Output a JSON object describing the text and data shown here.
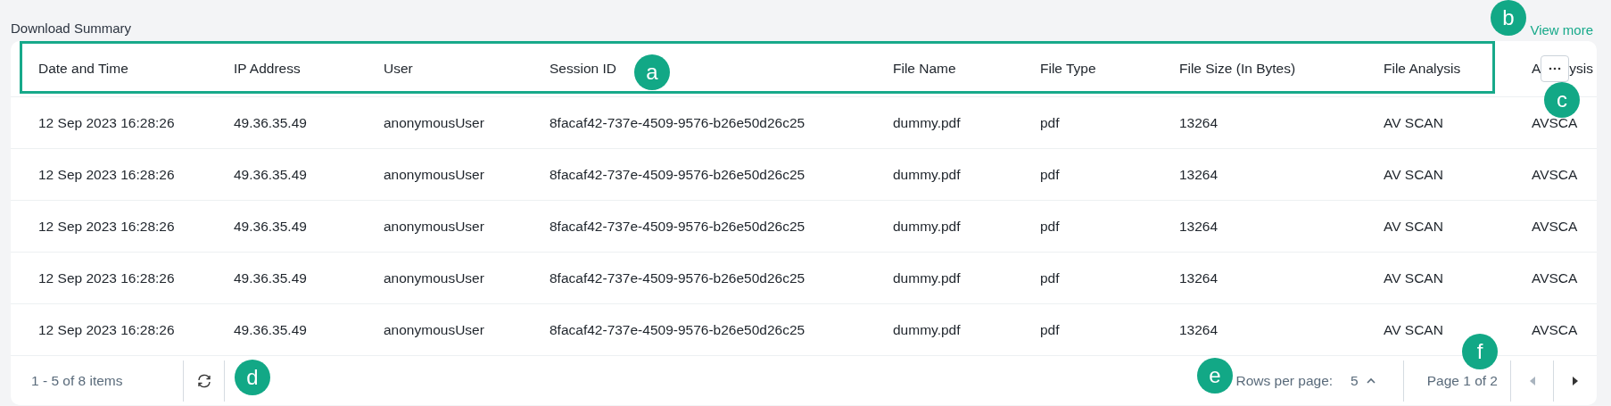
{
  "title": "Download Summary",
  "view_more": "View more",
  "table": {
    "columns": [
      "Date and Time",
      "IP Address",
      "User",
      "Session ID",
      "File Name",
      "File Type",
      "File Size (In Bytes)",
      "File Analysis"
    ],
    "column_9": {
      "label_start": "A",
      "label_end": "ysis"
    },
    "rows": [
      {
        "cells": [
          "12 Sep 2023 16:28:26",
          "49.36.35.49",
          "anonymousUser",
          "8facaf42-737e-4509-9576-b26e50d26c25",
          "dummy.pdf",
          "pdf",
          "13264",
          "AV SCAN",
          "AVSCA"
        ]
      },
      {
        "cells": [
          "12 Sep 2023 16:28:26",
          "49.36.35.49",
          "anonymousUser",
          "8facaf42-737e-4509-9576-b26e50d26c25",
          "dummy.pdf",
          "pdf",
          "13264",
          "AV SCAN",
          "AVSCA"
        ]
      },
      {
        "cells": [
          "12 Sep 2023 16:28:26",
          "49.36.35.49",
          "anonymousUser",
          "8facaf42-737e-4509-9576-b26e50d26c25",
          "dummy.pdf",
          "pdf",
          "13264",
          "AV SCAN",
          "AVSCA"
        ]
      },
      {
        "cells": [
          "12 Sep 2023 16:28:26",
          "49.36.35.49",
          "anonymousUser",
          "8facaf42-737e-4509-9576-b26e50d26c25",
          "dummy.pdf",
          "pdf",
          "13264",
          "AV SCAN",
          "AVSCA"
        ]
      },
      {
        "cells": [
          "12 Sep 2023 16:28:26",
          "49.36.35.49",
          "anonymousUser",
          "8facaf42-737e-4509-9576-b26e50d26c25",
          "dummy.pdf",
          "pdf",
          "13264",
          "AV SCAN",
          "AVSCA"
        ]
      }
    ]
  },
  "footer": {
    "item_count": "1 - 5 of 8 items",
    "rows_per_page_label": "Rows per page:",
    "rows_per_page_value": "5",
    "page_info": "Page 1 of 2",
    "prev_disabled": true,
    "next_disabled": false
  },
  "callouts": [
    {
      "letter": "a",
      "kind": "header"
    },
    {
      "letter": "b",
      "kind": "viewmore"
    },
    {
      "letter": "c",
      "kind": "columns"
    },
    {
      "letter": "d",
      "kind": "refresh"
    },
    {
      "letter": "e",
      "kind": "rows"
    },
    {
      "letter": "f",
      "kind": "page"
    }
  ]
}
